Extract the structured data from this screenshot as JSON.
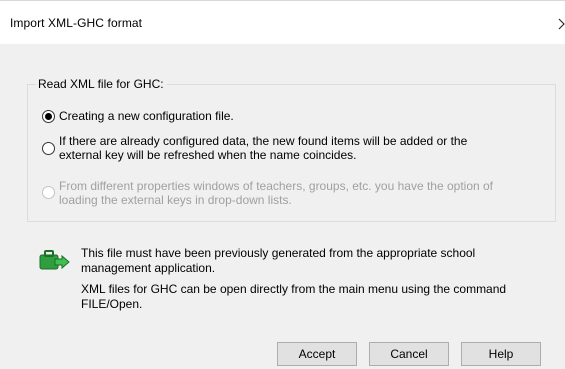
{
  "dialog": {
    "title": "Import XML-GHC format",
    "close_symbol": "›"
  },
  "group": {
    "label": "Read XML file for GHC:"
  },
  "options": [
    {
      "label": "Creating a new configuration file.",
      "selected": true,
      "enabled": true
    },
    {
      "label_line1": "If there are already configured data, the new found items will be added or the",
      "label_line2": "external key will be refreshed when the name coincides.",
      "selected": false,
      "enabled": true
    },
    {
      "label_line1": "From different properties windows of teachers, groups, etc. you have the option of",
      "label_line2": "loading the external keys in drop-down lists.",
      "selected": false,
      "enabled": false
    }
  ],
  "info": {
    "icon": "green-briefcase-arrow-icon",
    "line1": "This file must have been previously generated from the appropriate school",
    "line2": "management application.",
    "line3": "XML files for GHC can be open directly from the main menu using the command",
    "line4": "FILE/Open."
  },
  "buttons": {
    "accept": "Accept",
    "cancel": "Cancel",
    "help": "Help"
  },
  "colors": {
    "background": "#f0f0f0",
    "titlebar": "#ffffff",
    "icon_green": "#2e9e3e",
    "disabled_text": "#a0a0a0"
  }
}
